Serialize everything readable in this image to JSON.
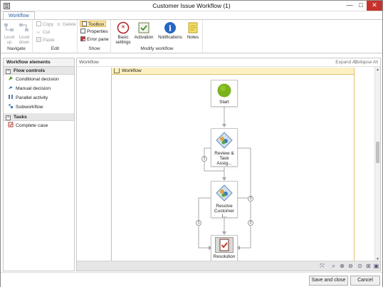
{
  "window": {
    "title": "Customer Issue Workflow (1)",
    "min": "—",
    "max": "□",
    "close": "✕"
  },
  "ribbon": {
    "tab": "Workflow",
    "navigate": {
      "label": "Navigate",
      "level_up": "Level up",
      "level_down": "Level down"
    },
    "edit": {
      "label": "Edit",
      "copy": "Copy",
      "delete": "Delete",
      "cut": "Cut",
      "paste": "Paste"
    },
    "show": {
      "label": "Show",
      "toolbox": "Toolbox",
      "properties": "Properties",
      "error_pane": "Error pane"
    },
    "modify": {
      "label": "Modify workflow",
      "basic_settings": "Basic settings",
      "activation": "Activation",
      "notifications": "Notifications",
      "notes": "Notes"
    }
  },
  "left_panel": {
    "header": "Workflow elements",
    "sections": [
      {
        "title": "Flow controls",
        "toggle": "−",
        "items": [
          "Conditional decision",
          "Manual decision",
          "Parallel activity",
          "Subworkflow"
        ]
      },
      {
        "title": "Tasks",
        "toggle": "−",
        "items": [
          "Complete case"
        ]
      }
    ]
  },
  "canvas": {
    "breadcrumb": "Workflow",
    "expand_all": "Expand All",
    "collapse_all": "Collapse All",
    "sequence_title": "Workflow",
    "nodes": [
      {
        "id": "start",
        "label": "Start"
      },
      {
        "id": "review",
        "label1": "Review &",
        "label2": "Task Assig..."
      },
      {
        "id": "resolve",
        "label1": "Resolve",
        "label2": "Customer I..."
      },
      {
        "id": "resolution",
        "label": "Resolution"
      }
    ],
    "edge_labels": [
      "1",
      "2",
      "1",
      "2"
    ],
    "colors": {
      "start": "#7cb31c",
      "sequence_header": "#fdf0c2"
    }
  },
  "footer": {
    "save_close": "Save and close",
    "cancel": "Cancel"
  }
}
